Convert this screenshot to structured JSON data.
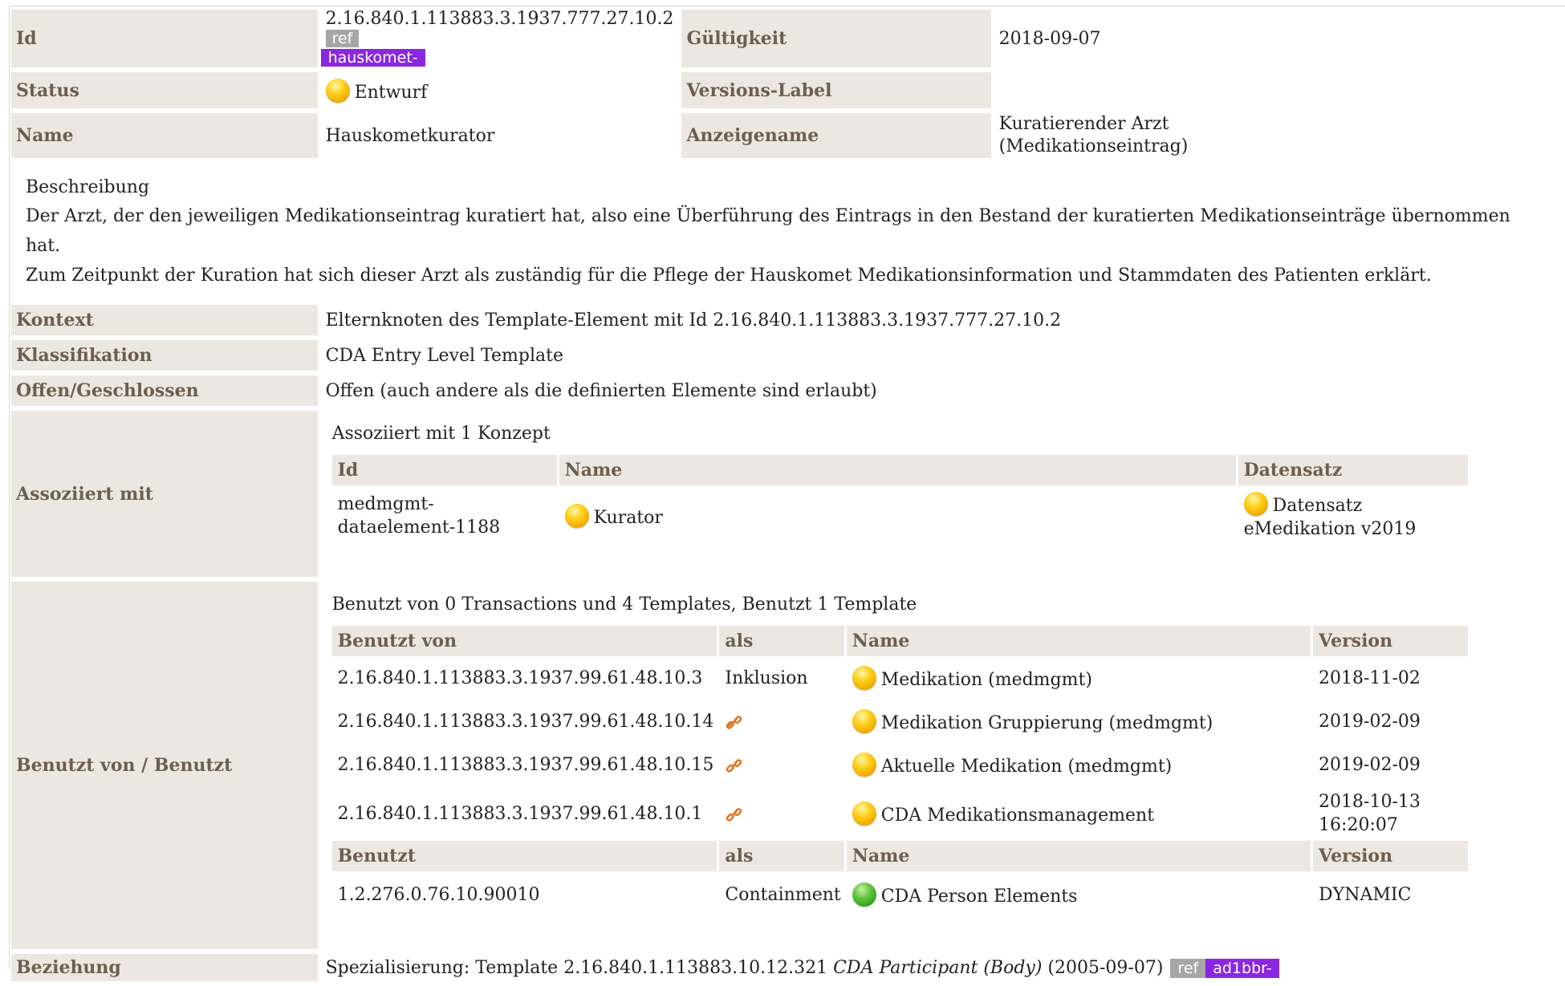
{
  "header": {
    "id_label": "Id",
    "id_value": "2.16.840.1.113883.3.1937.777.27.10.2",
    "id_ref_badge": "ref",
    "id_prefix_badge": "hauskomet-",
    "gueltigkeit_label": "Gültigkeit",
    "gueltigkeit_value": "2018-09-07",
    "status_label": "Status",
    "status_value": "Entwurf",
    "status_icon": "draft-status-yellow-dot",
    "versions_label": "Versions-Label",
    "versions_value": "",
    "name_label": "Name",
    "name_value": "Hauskometkurator",
    "anzeigename_label": "Anzeigename",
    "anzeigename_value_line1": "Kuratierender Arzt",
    "anzeigename_value_line2": "(Medikationseintrag)"
  },
  "description": {
    "title": "Beschreibung",
    "line1": "Der Arzt, der den jeweiligen Medikationseintrag kuratiert hat, also eine Überführung des Eintrags in den Bestand der kuratierten Medikationseinträge übernommen hat.",
    "line2": "Zum Zeitpunkt der Kuration hat sich dieser Arzt als zuständig für die Pflege der Hauskomet Medikationsinformation und Stammdaten des Patienten erklärt."
  },
  "properties": {
    "kontext_label": "Kontext",
    "kontext_value": "Elternknoten des Template-Element mit Id 2.16.840.1.113883.3.1937.777.27.10.2",
    "klassifikation_label": "Klassifikation",
    "klassifikation_value": "CDA Entry Level Template",
    "offen_label": "Offen/Geschlossen",
    "offen_value": "Offen (auch andere als die definierten Elemente sind erlaubt)"
  },
  "associated": {
    "label": "Assoziiert mit",
    "caption": "Assoziiert mit 1 Konzept",
    "columns": [
      "Id",
      "Name",
      "Datensatz"
    ],
    "rows": [
      {
        "id_line1": "medmgmt-",
        "id_line2": "dataelement-1188",
        "name": "Kurator",
        "dataset_line1": "Datensatz",
        "dataset_line2": "eMedikation v2019"
      }
    ]
  },
  "usage": {
    "label": "Benutzt von / Benutzt",
    "caption": "Benutzt von 0 Transactions und 4 Templates, Benutzt 1 Template",
    "used_by_columns": [
      "Benutzt von",
      "als",
      "Name",
      "Version"
    ],
    "used_by_rows": [
      {
        "id": "2.16.840.1.113883.3.1937.99.61.48.10.3",
        "als": "Inklusion",
        "name": "Medikation (medmgmt)",
        "version": "2018-11-02"
      },
      {
        "id": "2.16.840.1.113883.3.1937.99.61.48.10.14",
        "als": "",
        "name": "Medikation Gruppierung (medmgmt)",
        "version": "2019-02-09"
      },
      {
        "id": "2.16.840.1.113883.3.1937.99.61.48.10.15",
        "als": "",
        "name": "Aktuelle Medikation (medmgmt)",
        "version": "2019-02-09"
      },
      {
        "id": "2.16.840.1.113883.3.1937.99.61.48.10.1",
        "als": "",
        "name": "CDA Medikationsmanagement",
        "version_line1": "2018-10-13",
        "version_line2": "16:20:07"
      }
    ],
    "uses_columns": [
      "Benutzt",
      "als",
      "Name",
      "Version"
    ],
    "uses_rows": [
      {
        "id": "1.2.276.0.76.10.90010",
        "als": "Containment",
        "name": "CDA Person Elements",
        "version": "DYNAMIC"
      }
    ]
  },
  "relation": {
    "label": "Beziehung",
    "prefix": "Spezialisierung: Template 2.16.840.1.113883.10.12.321",
    "template_name": "CDA Participant (Body)",
    "date": "(2005-09-07)",
    "ref_badge": "ref",
    "prefix_badge": "ad1bbr-"
  },
  "colors": {
    "label_bg": "#ece8e1",
    "label_text": "#6d5e50",
    "ref_badge": "#a6a6a6",
    "prefix_badge": "#8b27e0",
    "status_draft": "#ffd21f",
    "status_active": "#5fc43c",
    "link_icon": "#e07a2a"
  }
}
